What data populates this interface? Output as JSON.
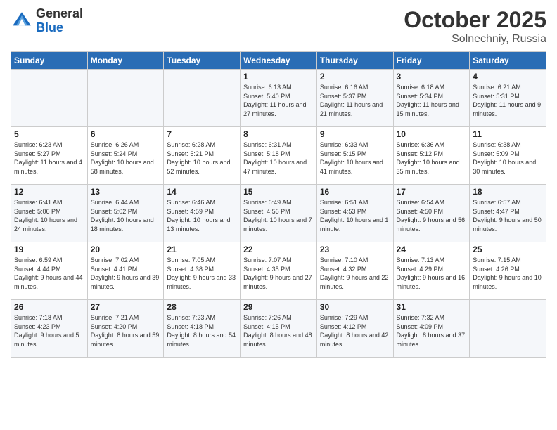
{
  "header": {
    "logo_general": "General",
    "logo_blue": "Blue",
    "month": "October 2025",
    "location": "Solnechniy, Russia"
  },
  "weekdays": [
    "Sunday",
    "Monday",
    "Tuesday",
    "Wednesday",
    "Thursday",
    "Friday",
    "Saturday"
  ],
  "weeks": [
    [
      {
        "day": "",
        "info": ""
      },
      {
        "day": "",
        "info": ""
      },
      {
        "day": "",
        "info": ""
      },
      {
        "day": "1",
        "info": "Sunrise: 6:13 AM\nSunset: 5:40 PM\nDaylight: 11 hours\nand 27 minutes."
      },
      {
        "day": "2",
        "info": "Sunrise: 6:16 AM\nSunset: 5:37 PM\nDaylight: 11 hours\nand 21 minutes."
      },
      {
        "day": "3",
        "info": "Sunrise: 6:18 AM\nSunset: 5:34 PM\nDaylight: 11 hours\nand 15 minutes."
      },
      {
        "day": "4",
        "info": "Sunrise: 6:21 AM\nSunset: 5:31 PM\nDaylight: 11 hours\nand 9 minutes."
      }
    ],
    [
      {
        "day": "5",
        "info": "Sunrise: 6:23 AM\nSunset: 5:27 PM\nDaylight: 11 hours\nand 4 minutes."
      },
      {
        "day": "6",
        "info": "Sunrise: 6:26 AM\nSunset: 5:24 PM\nDaylight: 10 hours\nand 58 minutes."
      },
      {
        "day": "7",
        "info": "Sunrise: 6:28 AM\nSunset: 5:21 PM\nDaylight: 10 hours\nand 52 minutes."
      },
      {
        "day": "8",
        "info": "Sunrise: 6:31 AM\nSunset: 5:18 PM\nDaylight: 10 hours\nand 47 minutes."
      },
      {
        "day": "9",
        "info": "Sunrise: 6:33 AM\nSunset: 5:15 PM\nDaylight: 10 hours\nand 41 minutes."
      },
      {
        "day": "10",
        "info": "Sunrise: 6:36 AM\nSunset: 5:12 PM\nDaylight: 10 hours\nand 35 minutes."
      },
      {
        "day": "11",
        "info": "Sunrise: 6:38 AM\nSunset: 5:09 PM\nDaylight: 10 hours\nand 30 minutes."
      }
    ],
    [
      {
        "day": "12",
        "info": "Sunrise: 6:41 AM\nSunset: 5:06 PM\nDaylight: 10 hours\nand 24 minutes."
      },
      {
        "day": "13",
        "info": "Sunrise: 6:44 AM\nSunset: 5:02 PM\nDaylight: 10 hours\nand 18 minutes."
      },
      {
        "day": "14",
        "info": "Sunrise: 6:46 AM\nSunset: 4:59 PM\nDaylight: 10 hours\nand 13 minutes."
      },
      {
        "day": "15",
        "info": "Sunrise: 6:49 AM\nSunset: 4:56 PM\nDaylight: 10 hours\nand 7 minutes."
      },
      {
        "day": "16",
        "info": "Sunrise: 6:51 AM\nSunset: 4:53 PM\nDaylight: 10 hours\nand 1 minute."
      },
      {
        "day": "17",
        "info": "Sunrise: 6:54 AM\nSunset: 4:50 PM\nDaylight: 9 hours\nand 56 minutes."
      },
      {
        "day": "18",
        "info": "Sunrise: 6:57 AM\nSunset: 4:47 PM\nDaylight: 9 hours\nand 50 minutes."
      }
    ],
    [
      {
        "day": "19",
        "info": "Sunrise: 6:59 AM\nSunset: 4:44 PM\nDaylight: 9 hours\nand 44 minutes."
      },
      {
        "day": "20",
        "info": "Sunrise: 7:02 AM\nSunset: 4:41 PM\nDaylight: 9 hours\nand 39 minutes."
      },
      {
        "day": "21",
        "info": "Sunrise: 7:05 AM\nSunset: 4:38 PM\nDaylight: 9 hours\nand 33 minutes."
      },
      {
        "day": "22",
        "info": "Sunrise: 7:07 AM\nSunset: 4:35 PM\nDaylight: 9 hours\nand 27 minutes."
      },
      {
        "day": "23",
        "info": "Sunrise: 7:10 AM\nSunset: 4:32 PM\nDaylight: 9 hours\nand 22 minutes."
      },
      {
        "day": "24",
        "info": "Sunrise: 7:13 AM\nSunset: 4:29 PM\nDaylight: 9 hours\nand 16 minutes."
      },
      {
        "day": "25",
        "info": "Sunrise: 7:15 AM\nSunset: 4:26 PM\nDaylight: 9 hours\nand 10 minutes."
      }
    ],
    [
      {
        "day": "26",
        "info": "Sunrise: 7:18 AM\nSunset: 4:23 PM\nDaylight: 9 hours\nand 5 minutes."
      },
      {
        "day": "27",
        "info": "Sunrise: 7:21 AM\nSunset: 4:20 PM\nDaylight: 8 hours\nand 59 minutes."
      },
      {
        "day": "28",
        "info": "Sunrise: 7:23 AM\nSunset: 4:18 PM\nDaylight: 8 hours\nand 54 minutes."
      },
      {
        "day": "29",
        "info": "Sunrise: 7:26 AM\nSunset: 4:15 PM\nDaylight: 8 hours\nand 48 minutes."
      },
      {
        "day": "30",
        "info": "Sunrise: 7:29 AM\nSunset: 4:12 PM\nDaylight: 8 hours\nand 42 minutes."
      },
      {
        "day": "31",
        "info": "Sunrise: 7:32 AM\nSunset: 4:09 PM\nDaylight: 8 hours\nand 37 minutes."
      },
      {
        "day": "",
        "info": ""
      }
    ]
  ]
}
